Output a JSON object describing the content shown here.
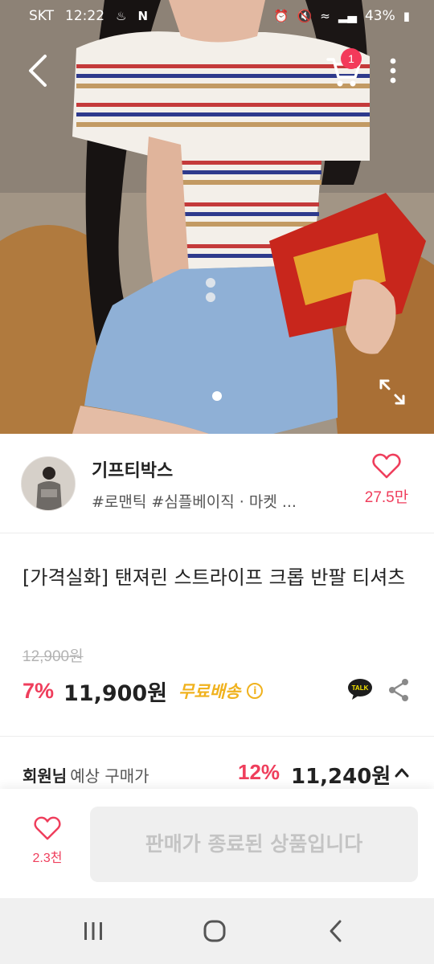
{
  "status_bar": {
    "carrier": "SKT",
    "time": "12:22",
    "battery": "43%"
  },
  "hero": {
    "cart_badge": "1",
    "image_index": 1,
    "image_count": 1
  },
  "shop": {
    "name": "기프티박스",
    "tags": "#로맨틱 #심플베이직 · 마켓 ...",
    "like_count": "27.5만"
  },
  "product": {
    "title": "[가격실화] 탠져린 스트라이프 크롭 반팔 티셔츠",
    "original_price": "12,900원",
    "discount": "7%",
    "price": "11,900원",
    "shipping": "무료배송"
  },
  "member_price": {
    "label_bold": "회원님",
    "label": "예상 구매가",
    "discount": "12%",
    "price": "11,240원"
  },
  "bottom": {
    "wish_count": "2.3천",
    "sold_out_label": "판매가 종료된 상품입니다"
  },
  "colors": {
    "accent": "#ef3e5c",
    "shipping": "#f0b21e"
  }
}
